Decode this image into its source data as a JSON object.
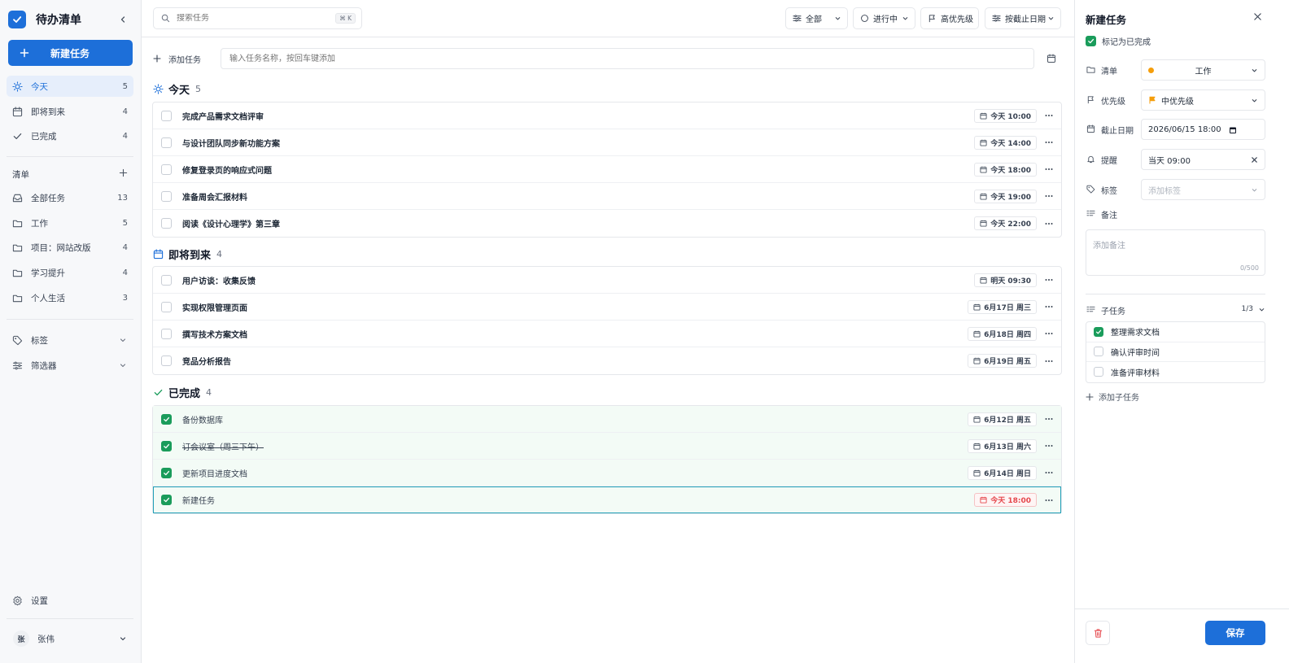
{
  "app": {
    "title": "待办清单"
  },
  "sidebar": {
    "new_task_label": "新建任务",
    "views": [
      {
        "label": "今天",
        "count": "5"
      },
      {
        "label": "即将到来",
        "count": "4"
      },
      {
        "label": "已完成",
        "count": "4"
      }
    ],
    "lists_label": "清单",
    "lists": [
      {
        "label": "全部任务",
        "count": "13"
      },
      {
        "label": "工作",
        "count": "5"
      },
      {
        "label": "项目：网站改版",
        "count": "4"
      },
      {
        "label": "学习提升",
        "count": "4"
      },
      {
        "label": "个人生活",
        "count": "3"
      }
    ],
    "tags_label": "标签",
    "filters_label": "筛选器",
    "settings_label": "设置",
    "user": {
      "avatar": "张",
      "name": "张伟"
    }
  },
  "toolbar": {
    "search_placeholder": "搜索任务",
    "search_shortcut": "⌘ K",
    "filter_all": "全部",
    "filter_status": "进行中",
    "filter_priority": "高优先级",
    "sort_label": "按截止日期"
  },
  "quick_add": {
    "label": "添加任务",
    "placeholder": "输入任务名称，按回车键添加"
  },
  "groups": {
    "today": {
      "title": "今天",
      "count": "5",
      "tasks": [
        {
          "name": "完成产品需求文档评审",
          "due": "今天 10:00"
        },
        {
          "name": "与设计团队同步新功能方案",
          "due": "今天 14:00"
        },
        {
          "name": "修复登录页的响应式问题",
          "due": "今天 18:00"
        },
        {
          "name": "准备周会汇报材料",
          "due": "今天 19:00"
        },
        {
          "name": "阅读《设计心理学》第三章",
          "due": "今天 22:00"
        }
      ]
    },
    "upcoming": {
      "title": "即将到来",
      "count": "4",
      "tasks": [
        {
          "name": "用户访谈：收集反馈",
          "due": "明天 09:30"
        },
        {
          "name": "实现权限管理页面",
          "due": "6月17日 周三"
        },
        {
          "name": "撰写技术方案文档",
          "due": "6月18日 周四"
        },
        {
          "name": "竞品分析报告",
          "due": "6月19日 周五"
        }
      ]
    },
    "completed": {
      "title": "已完成",
      "count": "4",
      "tasks": [
        {
          "name": "备份数据库",
          "due": "6月12日 周五"
        },
        {
          "name": "订会议室（周三下午）",
          "due": "6月13日 周六"
        },
        {
          "name": "更新项目进度文档",
          "due": "6月14日 周日"
        },
        {
          "name": "新建任务",
          "due": "今天 18:00"
        }
      ]
    }
  },
  "panel": {
    "title": "新建任务",
    "mark_done_label": "标记为已完成",
    "list_label": "清单",
    "list_value": "工作",
    "priority_label": "优先级",
    "priority_value": "中优先级",
    "due_label": "截止日期",
    "due_value": "2026/06/15 18:00",
    "reminder_label": "提醒",
    "reminder_value": "当天 09:00",
    "tags_label": "标签",
    "tags_placeholder": "添加标签",
    "notes_label": "备注",
    "notes_placeholder": "添加备注",
    "notes_count": "0/500",
    "subtasks_label": "子任务",
    "subtasks_count": "1/3",
    "subtasks": [
      {
        "label": "整理需求文档",
        "done": true
      },
      {
        "label": "确认评审时间",
        "done": false
      },
      {
        "label": "准备评审材料",
        "done": false
      }
    ],
    "add_subtask_label": "添加子任务",
    "save_label": "保存"
  },
  "colors": {
    "accent": "#1d6fd9",
    "success": "#1a9c5b",
    "danger": "#e5484d",
    "list_dot": "#f59e0b",
    "priority_flag": "#f59e0b"
  }
}
